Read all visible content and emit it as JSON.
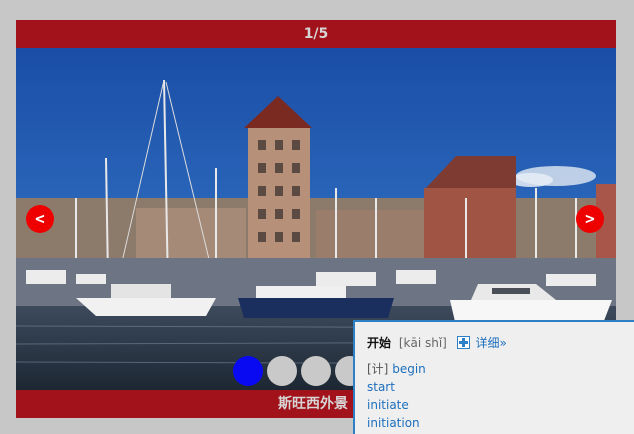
{
  "slider": {
    "counter": "1/5",
    "caption": "斯旺西外景",
    "prev_label": "<",
    "next_label": ">",
    "dots": [
      {
        "active": true
      },
      {
        "active": false
      },
      {
        "active": false
      },
      {
        "active": false
      }
    ]
  },
  "dictionary_popup": {
    "word": "开始",
    "pinyin": "[kāi shǐ]",
    "detail_link": "详细»",
    "tag": "[计]",
    "definitions": [
      "begin",
      "start",
      "initiate",
      "initiation"
    ]
  },
  "colors": {
    "bar_red": "#a1121b",
    "nav_red": "#ee0000",
    "active_dot": "#0a0af2",
    "inactive_dot": "#c9c9c9",
    "popup_border": "#2d7fc6",
    "link_blue": "#1d6fbd"
  },
  "icons": [
    "add-to-wordbook-icon"
  ]
}
